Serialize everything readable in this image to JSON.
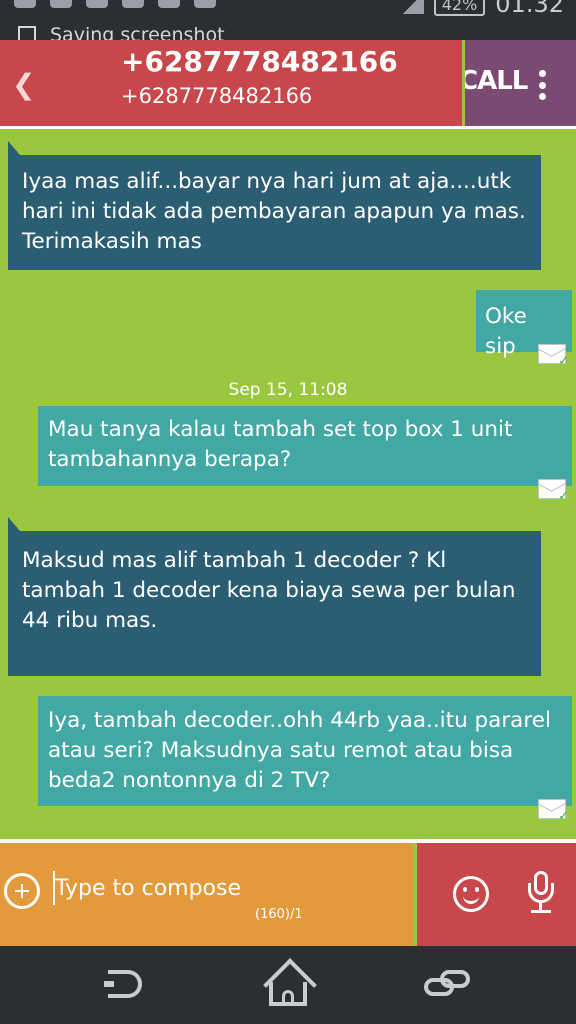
{
  "status_bar": {
    "time": "01.32",
    "battery": "42%",
    "notification": "Saving screenshot"
  },
  "header": {
    "title": "+6287778482166",
    "subtitle": "+6287778482166",
    "call_label": "CALL"
  },
  "messages": [
    {
      "direction": "incoming",
      "text": "Iyaa mas alif...bayar nya hari jum at aja....utk hari ini tidak ada pembayaran apapun ya mas. Terimakasih mas"
    },
    {
      "direction": "outgoing",
      "text": "Oke sip"
    },
    {
      "timestamp": "Sep 15, 11:08"
    },
    {
      "direction": "outgoing",
      "text": "Mau tanya kalau tambah set top box 1 unit tambahannya berapa?"
    },
    {
      "direction": "incoming",
      "text": "Maksud mas alif tambah 1 decoder ? Kl tambah 1 decoder  kena biaya sewa per bulan 44 ribu mas."
    },
    {
      "direction": "outgoing",
      "text": "Iya, tambah decoder..ohh 44rb yaa..itu pararel atau seri? Maksudnya satu remot atau bisa beda2 nontonnya di 2 TV?"
    }
  ],
  "compose": {
    "placeholder": "Type to compose",
    "counter": "(160)/1"
  },
  "icons": {
    "back": "chevron-left-icon",
    "menu": "kebab-menu-icon",
    "add": "add-circle-icon",
    "emoji": "smiley-icon",
    "voice": "microphone-icon",
    "delivered": "envelope-check-icon",
    "nav_back": "nav-back-icon",
    "nav_home": "nav-home-icon",
    "nav_recent": "nav-recent-icon"
  },
  "colors": {
    "chat_background": "#9bc63f",
    "header_red": "#c8474a",
    "call_purple": "#7b4a72",
    "incoming_bubble": "#2b5e73",
    "outgoing_bubble": "#42a8a4",
    "compose_orange": "#e39a3a"
  }
}
